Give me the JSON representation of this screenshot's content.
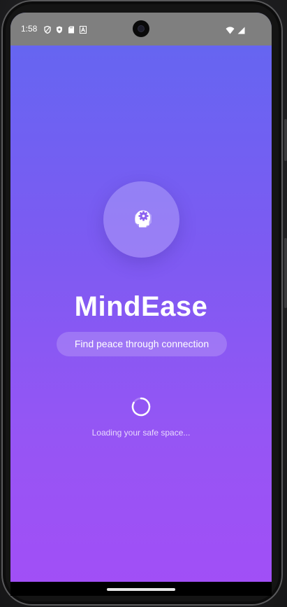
{
  "statusbar": {
    "time": "1:58",
    "left_icons": [
      "shield-icon",
      "vpn-shield-icon",
      "sd-card-icon",
      "font-icon"
    ],
    "right_icons": [
      "wifi-icon",
      "signal-icon"
    ]
  },
  "app": {
    "logo_icon": "head-gear-icon",
    "title": "MindEase",
    "tagline": "Find peace through connection",
    "loading_text": "Loading your safe space..."
  },
  "colors": {
    "gradient_top": "#6267f1",
    "gradient_bottom": "#a14ff6",
    "statusbar": "#7f7f7f"
  }
}
